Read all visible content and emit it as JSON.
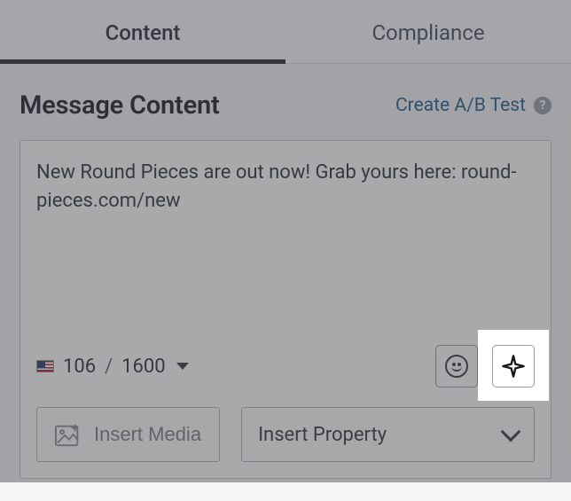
{
  "tabs": {
    "content": "Content",
    "compliance": "Compliance",
    "active": "content"
  },
  "header": {
    "title": "Message Content",
    "ab_link": "Create A/B Test"
  },
  "editor": {
    "text": "New Round Pieces are out now! Grab yours here: round-pieces.com/new",
    "char_count": "106",
    "char_limit": "1600"
  },
  "actions": {
    "insert_media": "Insert Media",
    "insert_property": "Insert Property"
  }
}
